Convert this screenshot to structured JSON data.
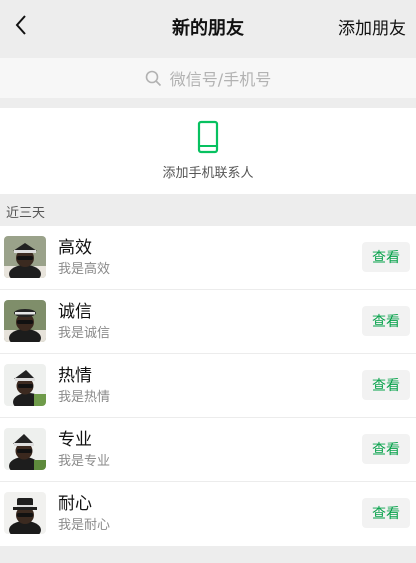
{
  "header": {
    "title": "新的朋友",
    "add_friend_label": "添加朋友"
  },
  "search": {
    "placeholder": "微信号/手机号"
  },
  "add_contacts": {
    "label": "添加手机联系人"
  },
  "section": {
    "label": "近三天"
  },
  "friends": [
    {
      "name": "高效",
      "message": "我是高效",
      "action": "查看"
    },
    {
      "name": "诚信",
      "message": "我是诚信",
      "action": "查看"
    },
    {
      "name": "热情",
      "message": "我是热情",
      "action": "查看"
    },
    {
      "name": "专业",
      "message": "我是专业",
      "action": "查看"
    },
    {
      "name": "耐心",
      "message": "我是耐心",
      "action": "查看"
    }
  ],
  "colors": {
    "accent": "#07c160",
    "action_text": "#07a24b",
    "background": "#ededed"
  },
  "icons": {
    "back": "chevron-left-icon",
    "search": "search-icon",
    "phone": "phone-icon"
  }
}
